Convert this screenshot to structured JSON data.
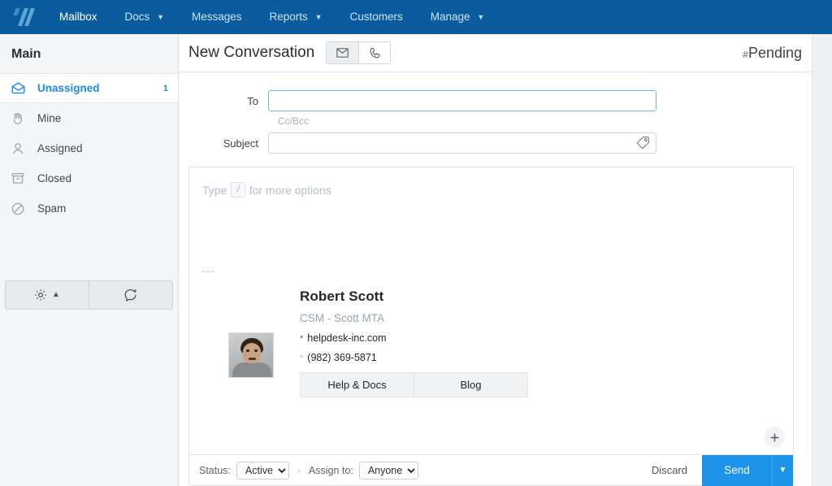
{
  "topnav": {
    "logo_name": "helpscout-logo",
    "items": [
      {
        "label": "Mailbox",
        "active": true,
        "caret": false
      },
      {
        "label": "Docs",
        "active": false,
        "caret": true
      },
      {
        "label": "Messages",
        "active": false,
        "caret": false
      },
      {
        "label": "Reports",
        "active": false,
        "caret": true
      },
      {
        "label": "Customers",
        "active": false,
        "caret": false
      },
      {
        "label": "Manage",
        "active": false,
        "caret": true
      }
    ]
  },
  "sidebar": {
    "title": "Main",
    "items": [
      {
        "label": "Unassigned",
        "icon": "open-envelope-icon",
        "count": "1",
        "active": true
      },
      {
        "label": "Mine",
        "icon": "hand-icon",
        "count": "",
        "active": false
      },
      {
        "label": "Assigned",
        "icon": "person-icon",
        "count": "",
        "active": false
      },
      {
        "label": "Closed",
        "icon": "archive-box-icon",
        "count": "",
        "active": false
      },
      {
        "label": "Spam",
        "icon": "ban-circle-icon",
        "count": "",
        "active": false
      }
    ],
    "footer": {
      "settings_icon": "gear-icon",
      "settings_caret": "chevron-up-icon",
      "new_conversation_icon": "new-chat-plus-icon"
    }
  },
  "header": {
    "title": "New Conversation",
    "email_toggle_icon": "envelope-icon",
    "phone_toggle_icon": "phone-icon",
    "status_tag_hash": "#",
    "status_tag_label": "Pending"
  },
  "form": {
    "to_label": "To",
    "to_value": "",
    "to_placeholder": "",
    "ccbcc_label": "Cc/Bcc",
    "subject_label": "Subject",
    "subject_value": "",
    "subject_placeholder": "",
    "subject_tag_icon": "tag-icon"
  },
  "editor": {
    "placeholder_prefix": "Type",
    "placeholder_key": "/",
    "placeholder_suffix": "for more options",
    "signature_separator": "---",
    "add_button_icon": "plus-icon",
    "signature": {
      "avatar_name": "signature-avatar-photo",
      "name": "Robert Scott",
      "role": "CSM - Scott MTA",
      "website_bullet": "*",
      "website": "helpdesk-inc.com",
      "phone_bullet": "*",
      "phone": "(982) 369-5871",
      "buttons": [
        "Help & Docs",
        "Blog"
      ]
    }
  },
  "footer": {
    "status_label": "Status:",
    "status_value": "Active",
    "status_options": [
      "Active"
    ],
    "separator": "›",
    "assign_label": "Assign to:",
    "assign_value": "Anyone",
    "assign_options": [
      "Anyone"
    ],
    "discard_label": "Discard",
    "send_label": "Send",
    "send_caret_icon": "chevron-down-icon"
  },
  "colors": {
    "nav_blue": "#0a5c9e",
    "accent_blue": "#1b8cec",
    "send_blue": "#1d94e8",
    "sidebar_bg": "#f4f5f6",
    "page_bg": "#eef0f2"
  }
}
